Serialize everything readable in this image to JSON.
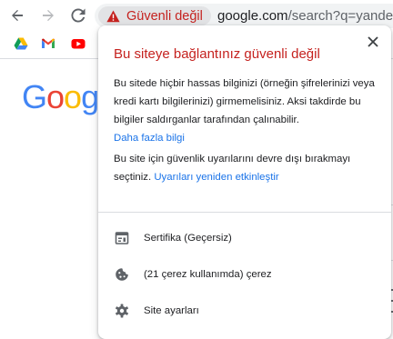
{
  "toolbar": {
    "security_chip_label": "Güvenli değil",
    "url_host": "google.com",
    "url_path": "/search?q=yandex&"
  },
  "bookmarks": {
    "items": [
      {
        "icon": "google-drive-icon"
      },
      {
        "icon": "gmail-icon"
      },
      {
        "icon": "youtube-icon"
      }
    ]
  },
  "page": {
    "logo_text": "Google"
  },
  "popup": {
    "title": "Bu siteye bağlantınız güvenli değil",
    "body_text": "Bu sitede hiçbir hassas bilginizi (örneğin şifrelerinizi veya kredi kartı bilgilerinizi) girmemelisiniz. Aksi takdirde bu bilgiler saldırganlar tarafından çalınabilir.",
    "learn_more_link": "Daha fazla bilgi",
    "warnings_text": "Bu site için güvenlik uyarılarını devre dışı bırakmayı seçtiniz.",
    "reenable_link": "Uyarıları yeniden etkinleştir",
    "rows": [
      {
        "label": "Sertifika (Geçersiz)",
        "icon": "certificate-icon"
      },
      {
        "label": "(21 çerez kullanımda) çerez",
        "icon": "cookie-icon"
      },
      {
        "label": "Site ayarları",
        "icon": "gear-icon"
      }
    ]
  },
  "colors": {
    "danger": "#c5221f",
    "link": "#1a73e8",
    "omnibox_bg": "#f1f3f4"
  }
}
